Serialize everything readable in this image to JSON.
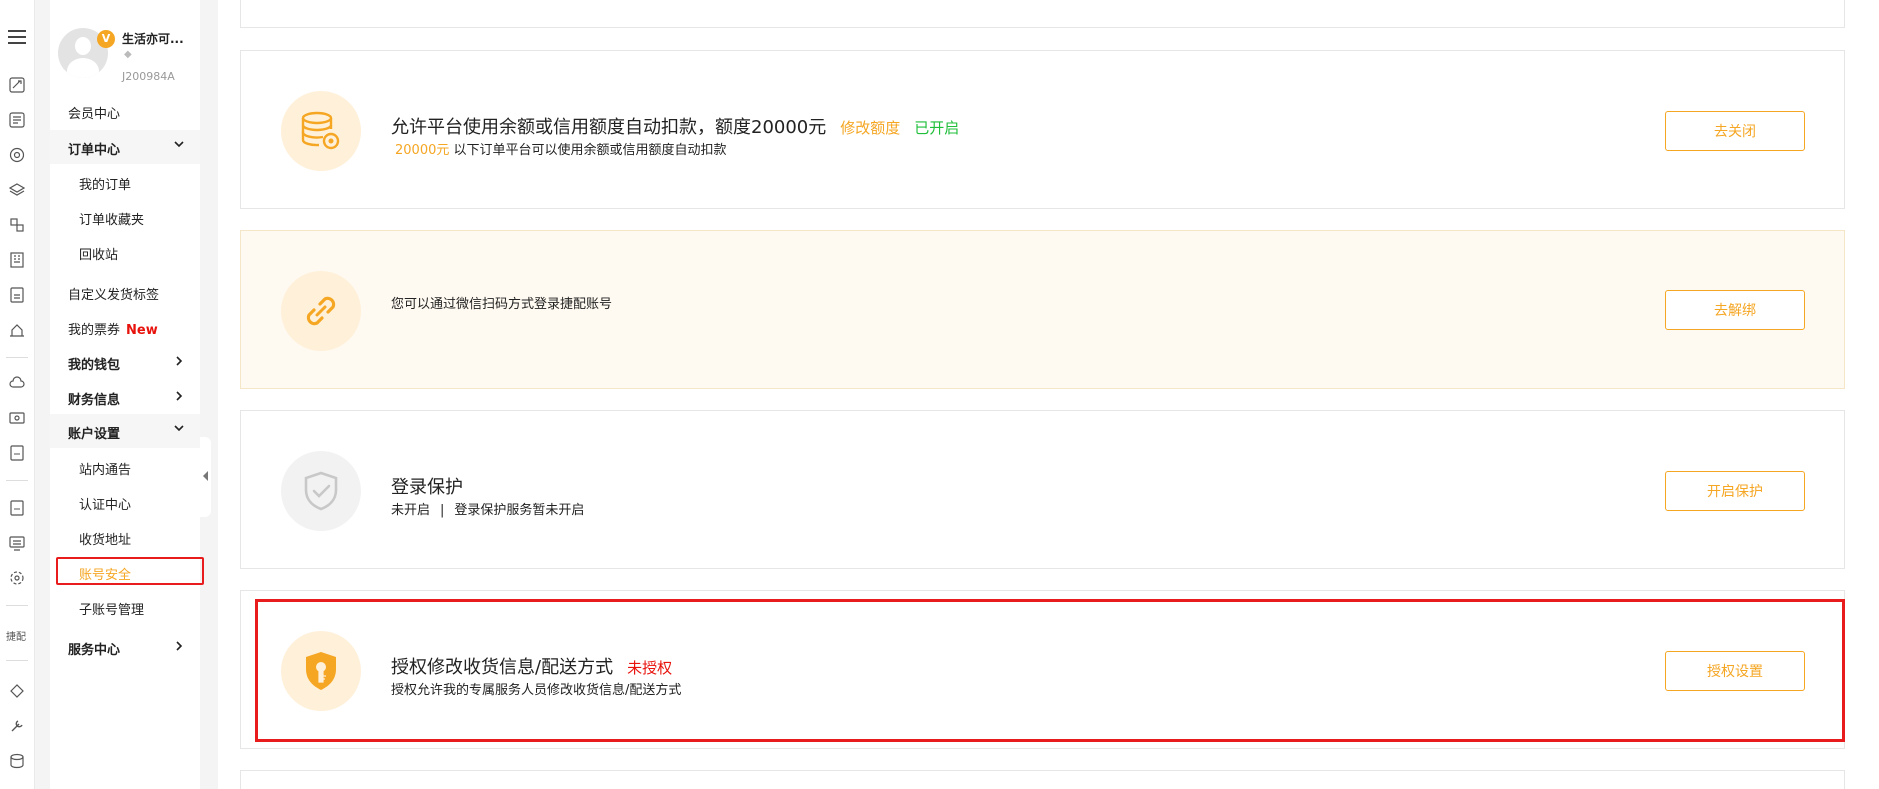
{
  "user": {
    "name": "生活亦可...",
    "vip_badge": "V",
    "id": "J200984A"
  },
  "rail": {
    "label": "捷配"
  },
  "sidebar": {
    "member_center": "会员中心",
    "order_center": "订单中心",
    "my_orders": "我的订单",
    "order_favorites": "订单收藏夹",
    "recycle_bin": "回收站",
    "custom_label": "自定义发货标签",
    "my_tickets": "我的票券",
    "new_tag": "New",
    "my_wallet": "我的钱包",
    "finance_info": "财务信息",
    "account_settings": "账户设置",
    "notices": "站内通告",
    "cert_center": "认证中心",
    "shipping_address": "收货地址",
    "account_security": "账号安全",
    "sub_accounts": "子账号管理",
    "service_center": "服务中心"
  },
  "cards": {
    "auto_deduct": {
      "title": "允许平台使用余额或信用额度自动扣款，额度20000元",
      "modify": "修改额度",
      "status": "已开启",
      "amount": "20000元",
      "desc": "以下订单平台可以使用余额或信用额度自动扣款",
      "button": "去关闭"
    },
    "wechat": {
      "desc": "您可以通过微信扫码方式登录捷配账号",
      "button": "去解绑"
    },
    "login_protect": {
      "title": "登录保护",
      "status": "未开启",
      "separator": "|",
      "desc": "登录保护服务暂未开启",
      "button": "开启保护"
    },
    "authorize": {
      "title": "授权修改收货信息/配送方式",
      "status": "未授权",
      "desc": "授权允许我的专属服务人员修改收货信息/配送方式",
      "button": "授权设置"
    }
  },
  "colors": {
    "accent": "#f5a623",
    "success": "#1fbf3a",
    "danger": "#e8120c"
  }
}
